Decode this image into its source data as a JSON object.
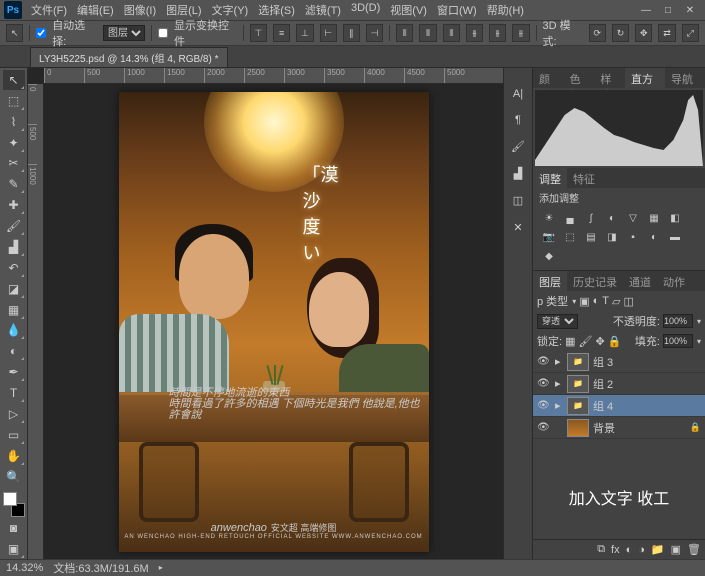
{
  "app_logo": "Ps",
  "menu": [
    "文件(F)",
    "编辑(E)",
    "图像(I)",
    "图层(L)",
    "文字(Y)",
    "选择(S)",
    "滤镜(T)",
    "3D(D)",
    "视图(V)",
    "窗口(W)",
    "帮助(H)"
  ],
  "options": {
    "auto_select": "自动选择:",
    "auto_target": "图层",
    "transform_controls": "显示变换控件",
    "mode_3d": "3D 模式:"
  },
  "tab": "LY3H5225.psd @ 14.3% (组 4, RGB/8) *",
  "ruler_h": [
    "0",
    "500",
    "1000",
    "1500",
    "2000",
    "2500",
    "3000",
    "3500",
    "4000",
    "4500",
    "5000"
  ],
  "ruler_v": [
    "0",
    "500",
    "1000"
  ],
  "artwork": {
    "vertical_text": "「漠\n沙\n度\nい",
    "small1": "時間是不停地流逝的東西",
    "small2": "時間看過了許多的相遇 下個時光是我們 他說是,他也許會說",
    "watermark": "anwenchao",
    "watermark_sub": "安文超 高端修图",
    "watermark_sub2": "AN WENCHAO HIGH-END RETOUCH OFFICIAL WEBSITE WWW.ANWENCHAO.COM"
  },
  "rpanel": {
    "tabs1": [
      "颜色",
      "色板",
      "样式",
      "直方图",
      "导航器"
    ],
    "tabs1_active": 3,
    "adj_tabs": [
      "调整",
      "特征"
    ],
    "adj_title": "添加调整",
    "tabs2": [
      "图层",
      "历史记录",
      "通道",
      "动作"
    ],
    "tabs2_active": 0,
    "kind": "p 类型",
    "blend": "穿透",
    "opacity_label": "不透明度:",
    "opacity": "100%",
    "lock_label": "锁定:",
    "fill_label": "填充:",
    "fill": "100%",
    "layers": [
      {
        "name": "组 3",
        "type": "folder",
        "vis": true
      },
      {
        "name": "组 2",
        "type": "folder",
        "vis": true
      },
      {
        "name": "组 4",
        "type": "folder",
        "vis": true,
        "active": true
      },
      {
        "name": "背景",
        "type": "img",
        "vis": true,
        "locked": true
      }
    ]
  },
  "annotation": "加入文字 收工",
  "status": {
    "zoom": "14.32%",
    "doc": "文档:63.3M/191.6M"
  }
}
